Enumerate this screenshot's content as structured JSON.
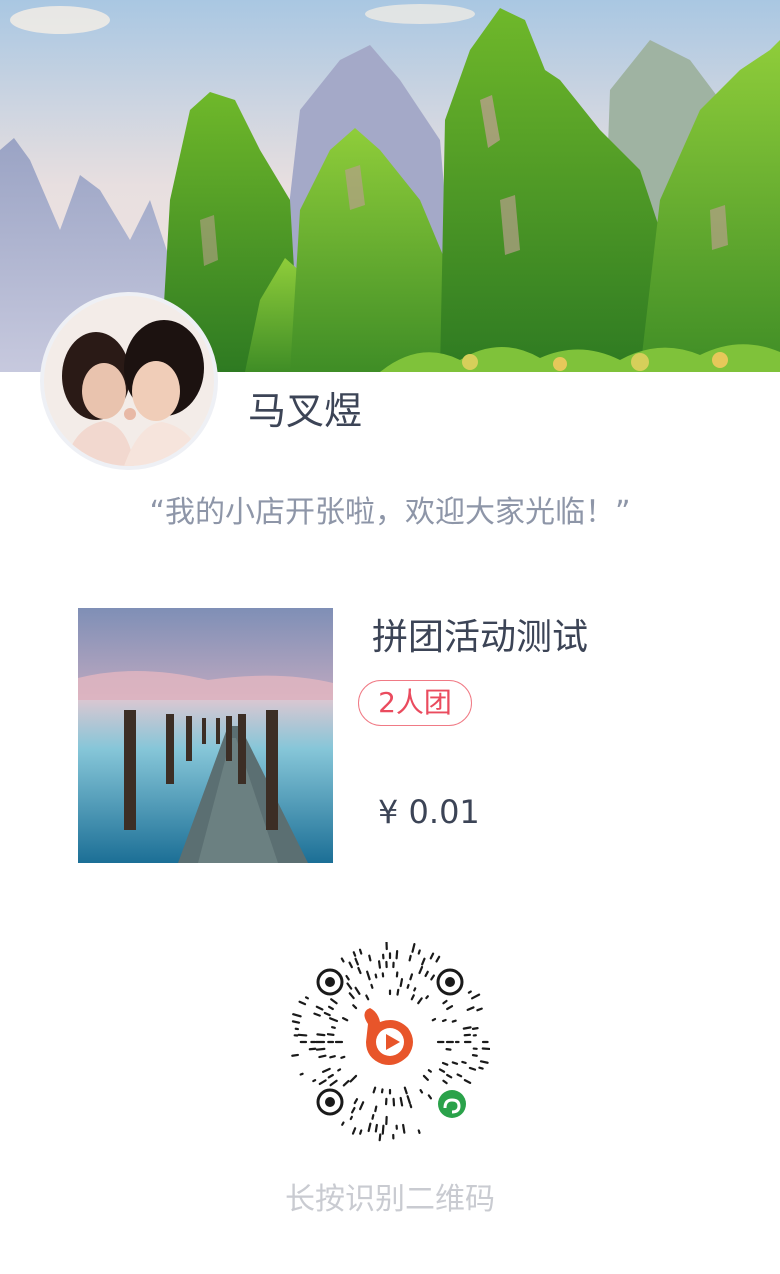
{
  "shop": {
    "name": "马叉煜",
    "motto": "“我的小店开张啦，欢迎大家光临！”"
  },
  "product": {
    "title": "拼团活动测试",
    "group_badge": "2人团",
    "price": "¥ 0.01"
  },
  "qr": {
    "hint": "长按识别二维码",
    "icon": "mini-program-qrcode"
  },
  "colors": {
    "text_primary": "#3c4456",
    "text_secondary": "#8e96a8",
    "badge_red": "#ea4b5e",
    "hint_gray": "#c9cbd1",
    "qr_logo_orange": "#e8552a",
    "mini_program_green": "#2aa24a"
  }
}
